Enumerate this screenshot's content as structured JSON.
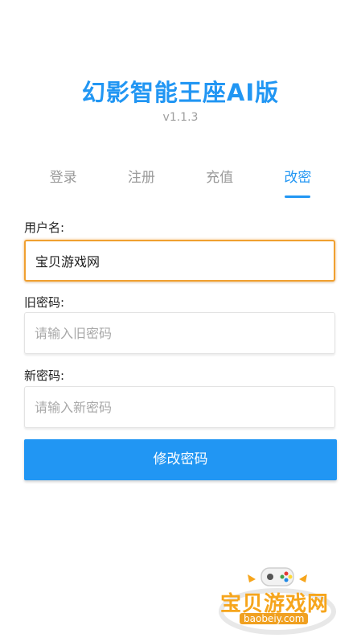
{
  "app": {
    "title": "幻影智能王座AI版",
    "version": "v1.1.3"
  },
  "tabs": [
    {
      "label": "登录",
      "active": false
    },
    {
      "label": "注册",
      "active": false
    },
    {
      "label": "充值",
      "active": false
    },
    {
      "label": "改密",
      "active": true
    }
  ],
  "form": {
    "username": {
      "label": "用户名:",
      "value": "宝贝游戏网"
    },
    "old_password": {
      "label": "旧密码:",
      "placeholder": "请输入旧密码"
    },
    "new_password": {
      "label": "新密码:",
      "placeholder": "请输入新密码"
    },
    "submit_label": "修改密码"
  },
  "watermark": {
    "text": "宝贝游戏网",
    "url": "baobeiy.com"
  },
  "colors": {
    "accent": "#2196f3",
    "focus_border": "#f0a030",
    "watermark": "#f6a51c"
  }
}
